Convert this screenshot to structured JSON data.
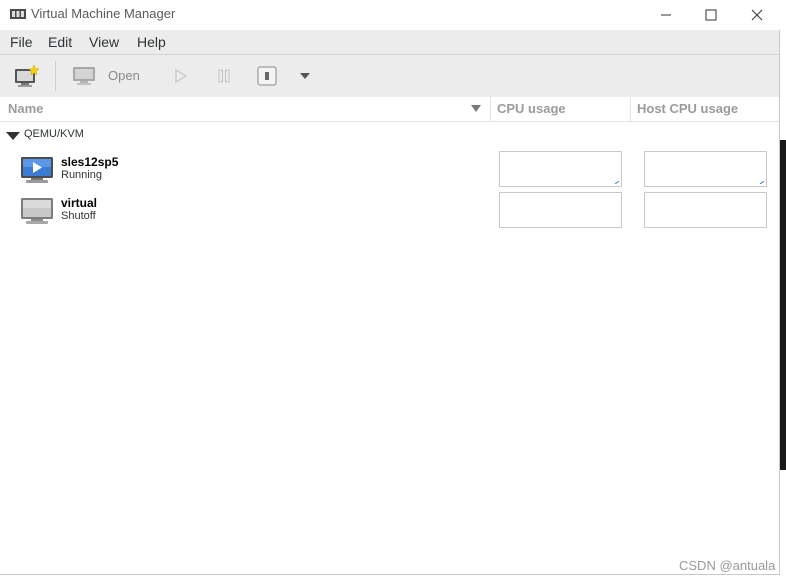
{
  "window": {
    "title": "Virtual Machine Manager"
  },
  "menu": [
    "File",
    "Edit",
    "View",
    "Help"
  ],
  "toolbar": {
    "open_label": "Open"
  },
  "columns": {
    "name": "Name",
    "cpu": "CPU usage",
    "host_cpu": "Host CPU usage"
  },
  "group": {
    "label": "QEMU/KVM"
  },
  "vms": [
    {
      "name": "sles12sp5",
      "state": "Running"
    },
    {
      "name": "virtual",
      "state": "Shutoff"
    }
  ],
  "watermark": "CSDN @antuala",
  "colors": {
    "running_accent": "#3a7bd5",
    "toolbar_bg": "#ececec"
  }
}
